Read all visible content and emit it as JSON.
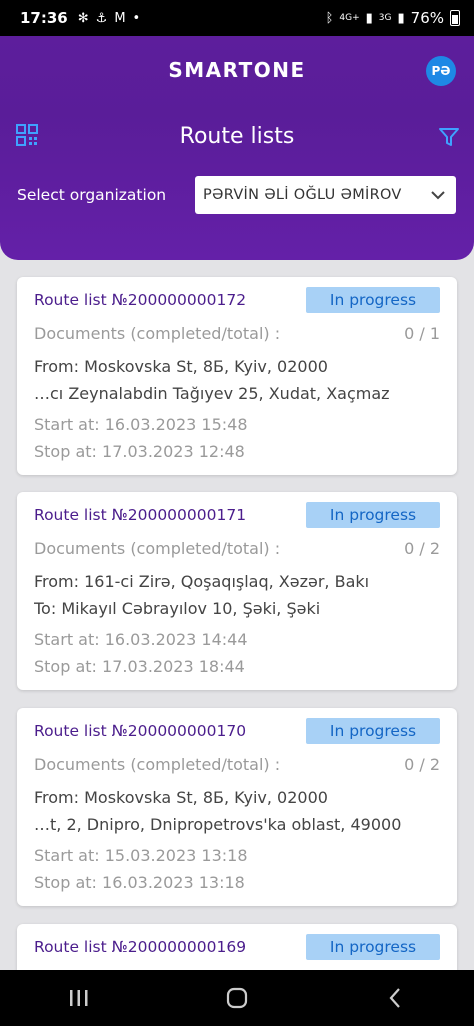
{
  "status_bar": {
    "time": "17:36",
    "left_icons": [
      "fan-icon",
      "anchor-icon",
      "mail-icon",
      "dot"
    ],
    "network": "4G+",
    "network2": "3G",
    "battery": "76%"
  },
  "header": {
    "brand": "SMARTONE",
    "avatar_initials": "PƏ",
    "title": "Route lists"
  },
  "organization": {
    "label": "Select organization",
    "value": "PƏRVİN ƏLİ OĞLU ƏMİROV"
  },
  "cards": [
    {
      "title": "Route list №200000000172",
      "status": "In progress",
      "docs_label": "Documents (completed/total) :",
      "docs_count": "0 / 1",
      "from": "From: Moskovska St, 8Б, Kyiv, 02000",
      "to": "…cı Zeynalabdin Tağıyev 25, Xudat, Xaçmaz",
      "start": "Start at: 16.03.2023 15:48",
      "stop": "Stop at: 17.03.2023 12:48"
    },
    {
      "title": "Route list №200000000171",
      "status": "In progress",
      "docs_label": "Documents (completed/total) :",
      "docs_count": "0 / 2",
      "from": "From: 161-ci Zirə, Qoşaqışlaq, Xəzər, Bakı",
      "to": "To: Mikayıl Cəbrayılov 10, Şəki, Şəki",
      "start": "Start at: 16.03.2023 14:44",
      "stop": "Stop at: 17.03.2023 18:44"
    },
    {
      "title": "Route list №200000000170",
      "status": "In progress",
      "docs_label": "Documents (completed/total) :",
      "docs_count": "0 / 2",
      "from": "From: Moskovska St, 8Б, Kyiv, 02000",
      "to": "…t, 2, Dnipro, Dnipropetrovs'ka oblast, 49000",
      "start": "Start at: 15.03.2023 13:18",
      "stop": "Stop at: 16.03.2023 13:18"
    },
    {
      "title": "Route list №200000000169",
      "status": "In progress"
    }
  ],
  "colors": {
    "header_purple": "#5d1e9c",
    "title_purple": "#4b1d8c",
    "badge_bg": "#a8d1f6",
    "badge_text": "#1466c5"
  }
}
